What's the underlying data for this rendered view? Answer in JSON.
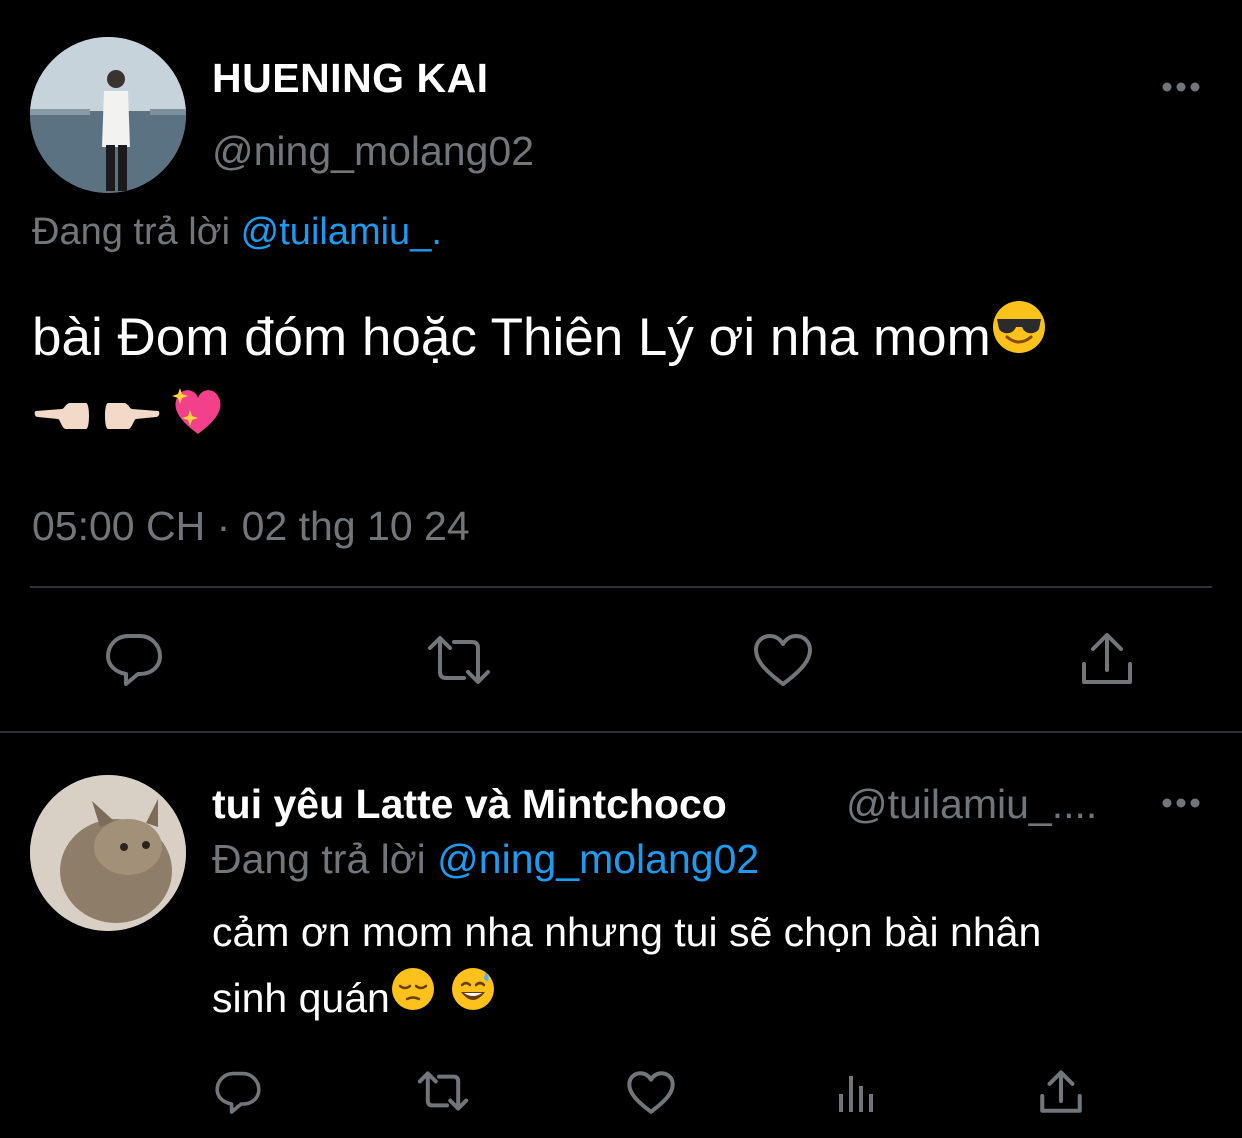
{
  "main_tweet": {
    "display_name": "HUENING KAI",
    "handle": "@ning_molang02",
    "replying_prefix": "Đang trả lời",
    "replying_to": "@tuilamiu_.",
    "text_line1": "bài Đom đóm hoặc Thiên Lý ơi nha mom",
    "emojis_line1": [
      "smiling-face-with-sunglasses"
    ],
    "emojis_line2": [
      "backhand-index-pointing-left",
      "backhand-index-pointing-right",
      "sparkling-heart"
    ],
    "timestamp": "05:00 CH · 02 thg 10 24",
    "actions": [
      "reply-icon",
      "retweet-icon",
      "like-icon",
      "share-icon"
    ]
  },
  "reply_tweet": {
    "display_name": "tui yêu Latte và Mintchoco",
    "handle": "@tuilamiu_....",
    "replying_prefix": "Đang trả lời",
    "replying_to": "@ning_molang02",
    "text_line1": "cảm ơn mom nha nhưng tui sẽ chọn bài nhân",
    "text_line2": "sinh quán",
    "emojis_line2": [
      "pensive-face",
      "grinning-face-with-sweat"
    ],
    "actions": [
      "reply-icon",
      "retweet-icon",
      "like-icon",
      "views-icon",
      "share-icon"
    ]
  },
  "colors": {
    "background": "#000000",
    "primary_text": "#ffffff",
    "secondary_text": "#71767b",
    "accent": "#1d9bf0",
    "divider": "#2f3336"
  }
}
